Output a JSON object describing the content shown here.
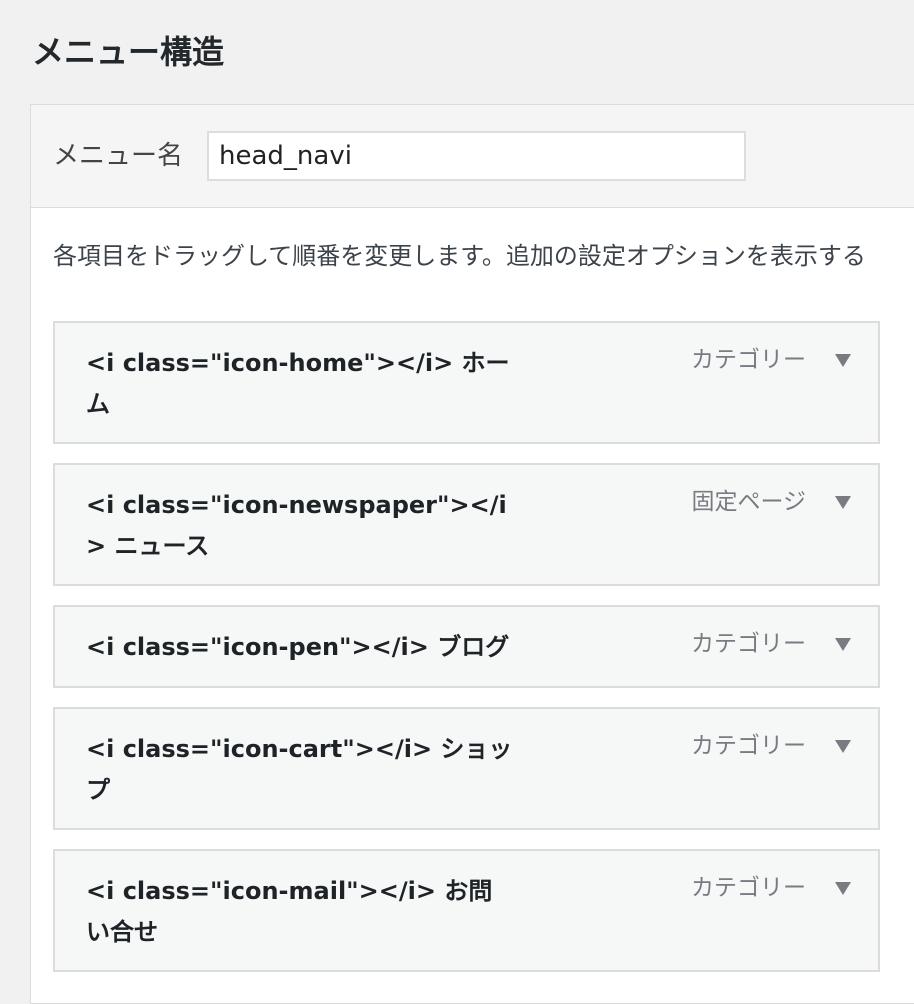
{
  "page": {
    "title": "メニュー構造"
  },
  "menu_name": {
    "label": "メニュー名",
    "value": "head_navi"
  },
  "instructions": "各項目をドラッグして順番を変更します。追加の設定オプションを表示する",
  "menu_items": [
    {
      "title": "<i class=\"icon-home\"></i> ホーム",
      "type": "カテゴリー"
    },
    {
      "title": "<i class=\"icon-newspaper\"></i> ニュース",
      "type": "固定ページ"
    },
    {
      "title": "<i class=\"icon-pen\"></i> ブログ",
      "type": "カテゴリー"
    },
    {
      "title": "<i class=\"icon-cart\"></i> ショップ",
      "type": "カテゴリー"
    },
    {
      "title": "<i class=\"icon-mail\"></i> お問い合せ",
      "type": "カテゴリー"
    }
  ],
  "icons": {
    "toggle": "triangle-down-icon"
  },
  "colors": {
    "toggle_arrow": "#787c82",
    "title_text": "#23282d"
  }
}
